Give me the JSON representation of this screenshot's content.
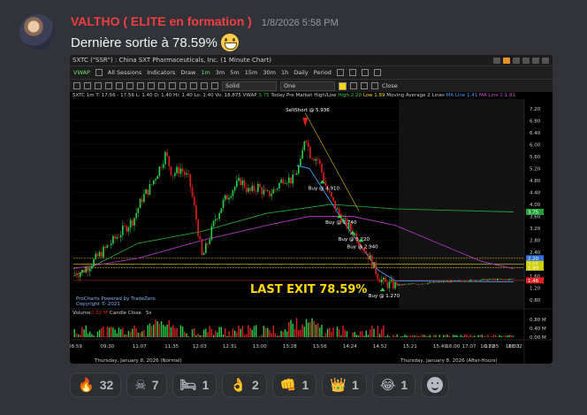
{
  "message": {
    "username": "VALTHO ( ELITE en formation )",
    "timestamp": "1/8/2026 5:58 PM",
    "text": "Dernière sortie à 78.59%",
    "emoji": "grinning-sweat-emoji"
  },
  "chart_window": {
    "title": "SXTC (\"SSR\") : China SXT Pharmaceuticals, Inc. (1 Minute Chart)",
    "toolbar1": {
      "indicator": "VWAP",
      "all_sessions": "All Sessions",
      "indicators": "Indicators",
      "draw": "Draw",
      "intervals": [
        "1m",
        "3m",
        "5m",
        "15m",
        "30m",
        "1h",
        "Daily",
        "Period"
      ]
    },
    "toolbar2": {
      "line_style": "Solid",
      "width": "One",
      "close": "Close"
    },
    "legend": {
      "symbol": "SXTC 1m",
      "ohlc": "T: 17:56 - 17:56  L: 1.40  O: 1.40  Hi: 1.40  Lo: 1.40  Vo: 18,875",
      "vwap_label": "VWAP",
      "vwap_value": "3.75",
      "today_label": "Today Pre Market High/Low",
      "high_label": "High",
      "high_value": "2.20",
      "low_label": "Low",
      "low_value": "1.89",
      "ma_label": "Moving Average 2 Lines",
      "ma1_label": "MA Line",
      "ma1_value": "1.41",
      "ma2_label": "MA Line 2",
      "ma2_value": "1.81"
    },
    "annotations": {
      "sell": "SellShort @ 5.936",
      "buys": [
        "Buy @ 4.910",
        "Buy @ 3.740",
        "Buy @ 3.220",
        "Buy @ 2.940",
        "Buy @ 1.270"
      ],
      "last_exit": "LAST EXIT 78.59%",
      "branding1": "ProCharts Powered by TradeZero",
      "branding2": "Copyright © 2021",
      "volume_label": "Volume",
      "volume_value": "0.02 M",
      "candle_close": "Candle Close",
      "candle_close_value": "5s"
    },
    "y_ticks": [
      "7.20",
      "6.80",
      "6.40",
      "6.00",
      "5.60",
      "5.20",
      "4.80",
      "4.40",
      "4.00",
      "3.60",
      "3.20",
      "2.80",
      "2.40",
      "2.00",
      "1.60",
      "1.20",
      "0.80"
    ],
    "price_tags": [
      {
        "label": "3.75",
        "color": "#1fa33a"
      },
      {
        "label": "2.20",
        "color": "#2f6fd8"
      },
      {
        "label": "2.01",
        "color": "#d0d000"
      },
      {
        "label": "1.89",
        "color": "#d0d000"
      },
      {
        "label": "1.46",
        "color": "#e02020"
      }
    ],
    "vol_ticks": [
      "0.80 M",
      "0.40 M",
      "0.00 M"
    ],
    "x_ticks": [
      "08:59",
      "09:30",
      "11:07",
      "11:35",
      "12:03",
      "12:31",
      "13:00",
      "13:28",
      "13:56",
      "14:24",
      "14:52",
      "15:21",
      "15:49",
      "16:00",
      "16:39",
      "17:07",
      "17:35",
      "18:03",
      "18:32"
    ],
    "x_ticks_extra": "10:2x",
    "date_left": "Thursday, January 8, 2026 (Normal)",
    "date_right": "Thursday, January 8, 2026 (After-Hours)"
  },
  "chart_data": {
    "type": "candlestick",
    "title": "SXTC (\"SSR\") : China SXT Pharmaceuticals, Inc. (1 Minute Chart)",
    "xlabel": "",
    "ylabel": "",
    "ylim": [
      0.6,
      7.4
    ],
    "price_path": [
      [
        0,
        1.7
      ],
      [
        4,
        1.75
      ],
      [
        8,
        2.0
      ],
      [
        12,
        2.3
      ],
      [
        16,
        2.6
      ],
      [
        20,
        2.9
      ],
      [
        24,
        3.2
      ],
      [
        28,
        3.5
      ],
      [
        32,
        4.2
      ],
      [
        36,
        4.6
      ],
      [
        40,
        5.2
      ],
      [
        43,
        5.7
      ],
      [
        46,
        5.0
      ],
      [
        50,
        5.2
      ],
      [
        54,
        4.8
      ],
      [
        57,
        3.6
      ],
      [
        60,
        2.2
      ],
      [
        63,
        2.8
      ],
      [
        66,
        3.5
      ],
      [
        70,
        4.1
      ],
      [
        74,
        4.5
      ],
      [
        78,
        4.8
      ],
      [
        82,
        4.4
      ],
      [
        86,
        4.6
      ],
      [
        90,
        4.3
      ],
      [
        94,
        4.5
      ],
      [
        98,
        4.9
      ],
      [
        102,
        4.8
      ],
      [
        106,
        5.4
      ],
      [
        108,
        6.4
      ],
      [
        110,
        5.7
      ],
      [
        114,
        5.5
      ],
      [
        118,
        4.5
      ],
      [
        122,
        3.9
      ],
      [
        126,
        3.4
      ],
      [
        130,
        3.1
      ],
      [
        134,
        2.7
      ],
      [
        138,
        2.2
      ],
      [
        142,
        1.6
      ],
      [
        145,
        1.35
      ],
      [
        150,
        1.3
      ],
      [
        160,
        1.35
      ],
      [
        175,
        1.42
      ],
      [
        190,
        1.48
      ],
      [
        205,
        1.5
      ]
    ],
    "vwap_line": [
      [
        0,
        1.6
      ],
      [
        30,
        2.7
      ],
      [
        60,
        3.1
      ],
      [
        90,
        3.7
      ],
      [
        120,
        4.0
      ],
      [
        150,
        3.85
      ],
      [
        205,
        3.75
      ]
    ],
    "ma_magenta": [
      [
        0,
        1.85
      ],
      [
        30,
        2.2
      ],
      [
        60,
        2.8
      ],
      [
        90,
        3.3
      ],
      [
        110,
        3.6
      ],
      [
        130,
        3.6
      ],
      [
        150,
        3.3
      ],
      [
        170,
        2.7
      ],
      [
        190,
        2.1
      ],
      [
        205,
        1.85
      ]
    ],
    "ma_blue": [
      [
        104,
        5.3
      ],
      [
        110,
        5.2
      ],
      [
        118,
        4.3
      ],
      [
        126,
        3.4
      ],
      [
        134,
        2.6
      ],
      [
        142,
        1.8
      ],
      [
        150,
        1.45
      ],
      [
        205,
        1.41
      ]
    ],
    "trend_line": [
      [
        108,
        7.05
      ],
      [
        133,
        3.78
      ]
    ],
    "pm_high": 2.2,
    "pm_low": 1.89,
    "level_201": 2.01,
    "last_price": 1.46
  }
}
